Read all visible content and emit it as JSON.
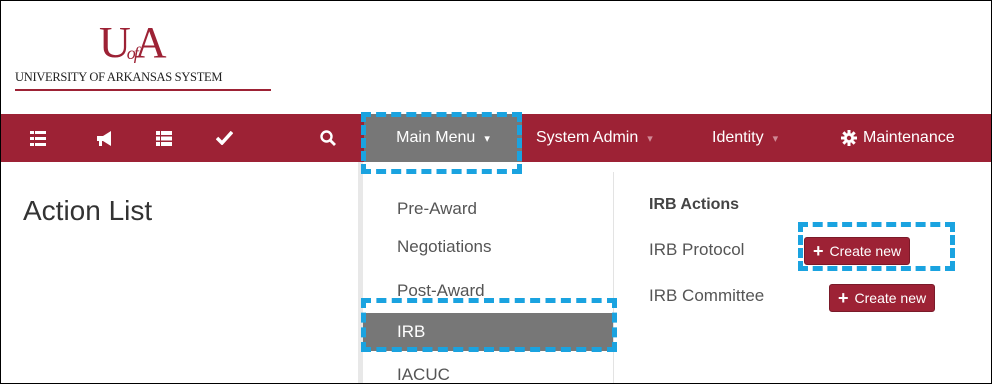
{
  "logo": {
    "mark_u": "U",
    "mark_of": "of",
    "mark_a": "A",
    "system_name": "UNIVERSITY OF ARKANSAS SYSTEM"
  },
  "colors": {
    "brand": "#9d2235",
    "active": "#777777",
    "highlight": "#1aa3e0"
  },
  "navbar": {
    "icons": [
      "list-icon",
      "megaphone-icon",
      "list-alt-icon",
      "checkmark-icon",
      "search-icon"
    ],
    "menus": [
      {
        "label": "Main Menu",
        "caret": "▾",
        "active": true
      },
      {
        "label": "System Admin",
        "caret": "▾"
      },
      {
        "label": "Identity",
        "caret": "▾"
      },
      {
        "label": "Maintenance",
        "icon": "gear-icon"
      }
    ]
  },
  "page": {
    "title": "Action List"
  },
  "dropdown": {
    "items": [
      {
        "label": "Pre-Award"
      },
      {
        "label": "Negotiations"
      },
      {
        "label": "Post-Award"
      },
      {
        "label": "IRB",
        "active": true
      },
      {
        "label": "IACUC"
      }
    ],
    "irb_actions": {
      "heading": "IRB Actions",
      "rows": [
        {
          "label": "IRB Protocol",
          "button": "Create new",
          "button_icon": "plus-icon"
        },
        {
          "label": "IRB Committee",
          "button": "Create new",
          "button_icon": "plus-icon"
        }
      ]
    }
  }
}
